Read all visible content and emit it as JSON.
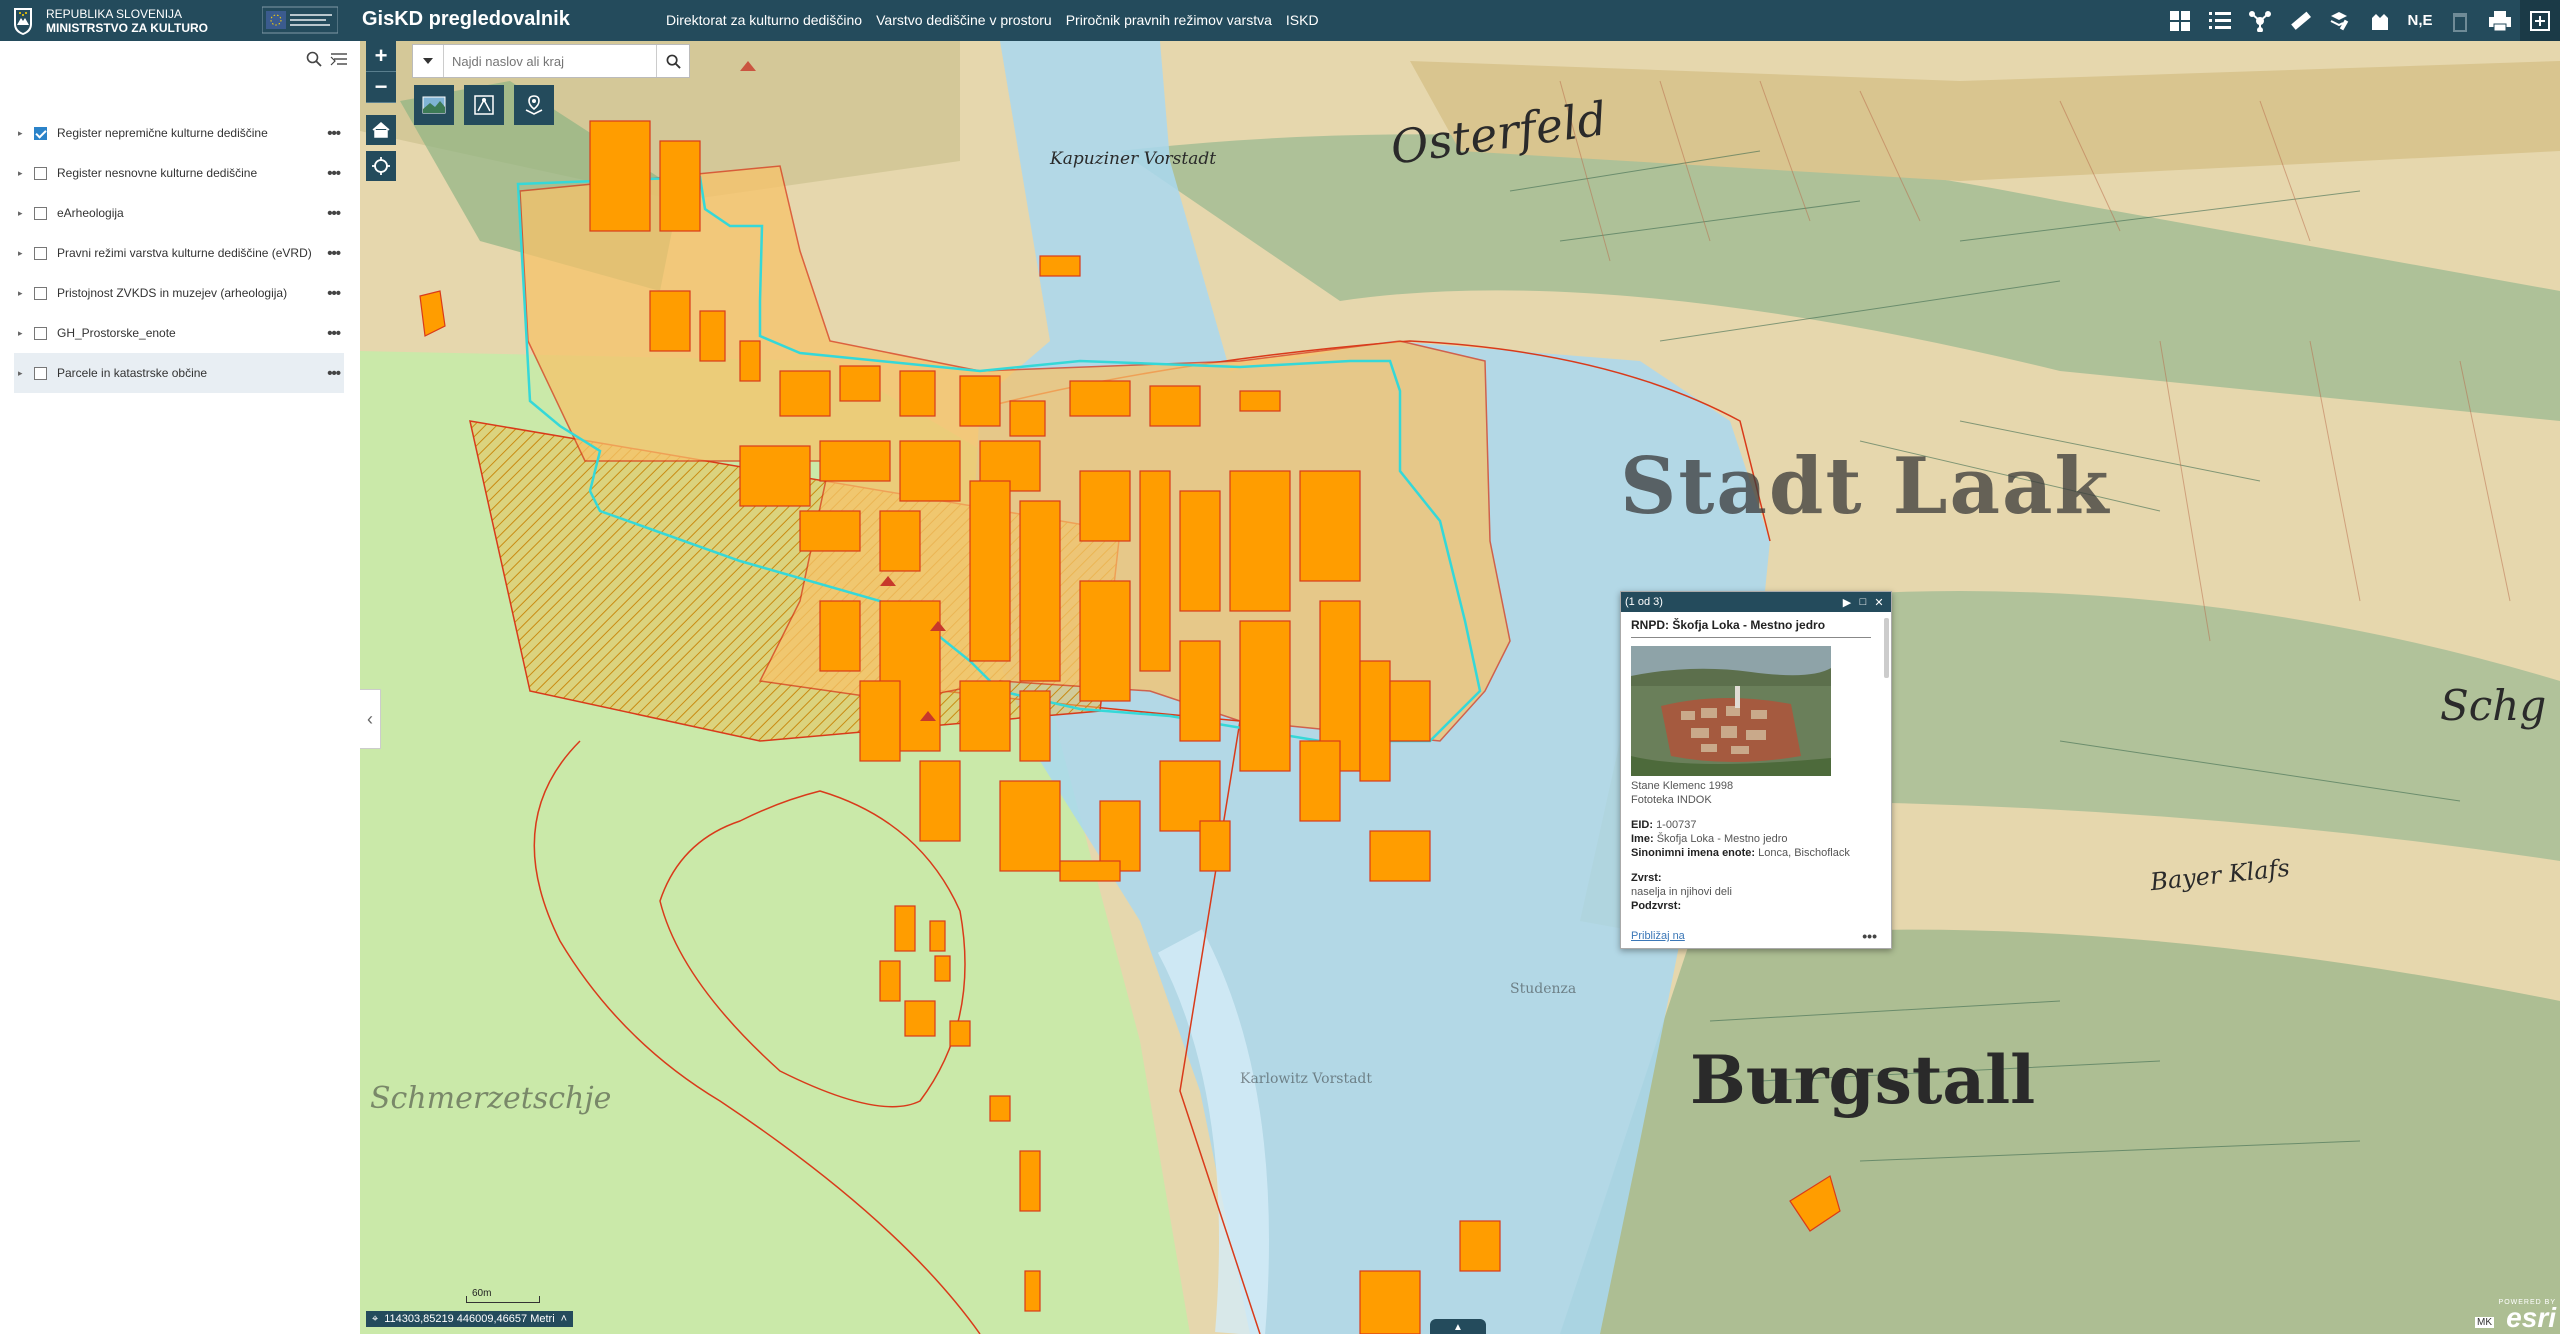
{
  "header": {
    "gov_line1": "REPUBLIKA SLOVENIJA",
    "gov_line2": "MINISTRSTVO ZA KULTURO",
    "app_title": "GisKD pregledovalnik",
    "nav": [
      "Direktorat za kulturno dediščino",
      "Varstvo dediščine v prostoru",
      "Priročnik pravnih režimov varstva",
      "ISKD"
    ],
    "tools": [
      "grid-icon",
      "list-icon",
      "network-icon",
      "ruler-icon",
      "layers-edit-icon",
      "bookmark-icon",
      "N,E",
      "trash-icon",
      "print-icon",
      "expand-icon"
    ],
    "coord_label": "N,E"
  },
  "layers": [
    {
      "label": "Register nepremične kulturne dediščine",
      "checked": true
    },
    {
      "label": "Register nesnovne kulturne dediščine",
      "checked": false
    },
    {
      "label": "eArheologija",
      "checked": false
    },
    {
      "label": "Pravni režimi varstva kulturne dediščine (eVRD)",
      "checked": false
    },
    {
      "label": "Pristojnost ZVKDS in muzejev (arheologija)",
      "checked": false
    },
    {
      "label": "GH_Prostorske_enote",
      "checked": false
    },
    {
      "label": "Parcele in katastrske občine",
      "checked": false,
      "selected": true
    }
  ],
  "search": {
    "placeholder": "Najdi naslov ali kraj"
  },
  "map": {
    "labels": [
      "Osterfeld",
      "Kapuziner Vorstadt",
      "Stadt Laak",
      "Burgstall",
      "Schmerzetschje",
      "Schg",
      "Studenza",
      "Karlowitz Vorstadt",
      "Bayer Klafs"
    ],
    "scale_label": "60m",
    "coords": "114303,85219 446009,46657 Metri",
    "esri_powered": "POWERED BY",
    "esri": "esri",
    "mk": "MK"
  },
  "popup": {
    "counter": "(1 od 3)",
    "title": "RNPD: Škofja Loka - Mestno jedro",
    "photo_author": "Stane Klemenc 1998",
    "photo_source": "Fototeka INDOK",
    "eid_label": "EID:",
    "eid": "1-00737",
    "ime_label": "Ime:",
    "ime": "Škofja Loka - Mestno jedro",
    "sinonimi_label": "Sinonimni imena enote:",
    "sinonimi": "Lonca, Bischoflack",
    "zvrst_label": "Zvrst:",
    "zvrst": "naselja in njihovi deli",
    "podzvrst_label": "Podzvrst:",
    "zoom_link": "Približaj na"
  },
  "colors": {
    "header": "#244b5c",
    "accent": "#2b83c9",
    "heritage_fill": "#ff9d00",
    "heritage_outline": "#d93a1a",
    "core_outline": "#35d8d8",
    "blue_zone": "#a9d8f0",
    "green_zone": "#c8eaa8"
  }
}
